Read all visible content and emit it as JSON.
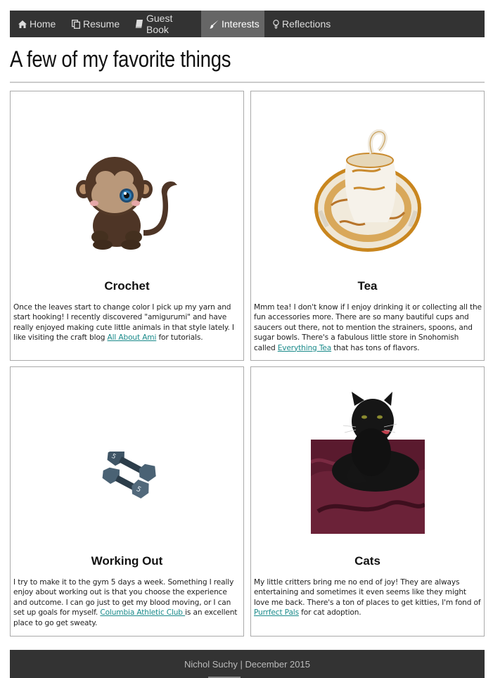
{
  "nav": {
    "items": [
      {
        "label": "Home",
        "icon": "home-icon",
        "active": false
      },
      {
        "label": "Resume",
        "icon": "copy-icon",
        "active": false
      },
      {
        "label": "Guest Book",
        "icon": "book-icon",
        "active": false
      },
      {
        "label": "Interests",
        "icon": "brush-icon",
        "active": true
      },
      {
        "label": "Reflections",
        "icon": "lightbulb-icon",
        "active": false
      }
    ]
  },
  "page": {
    "title": "A few of my favorite things"
  },
  "cards": [
    {
      "title": "Crochet",
      "image": "crochet-monkey-image",
      "text_before": "Once the leaves start to change color I pick up my yarn and start hooking! I recently discovered \"amigurumi\" and have really enjoyed making cute little animals in that style lately. I like visiting the craft blog ",
      "link": "All About Ami",
      "text_after": " for tutorials."
    },
    {
      "title": "Tea",
      "image": "teacup-image",
      "text_before": "Mmm tea! I don't know if I enjoy drinking it or collecting all the fun accessories more. There are so many bautiful cups and saucers out there, not to mention the strainers, spoons, and sugar bowls. There's a fabulous little store in Snohomish called ",
      "link": "Everything Tea",
      "text_after": " that has tons of flavors."
    },
    {
      "title": "Working Out",
      "image": "dumbbells-image",
      "text_before": "I try to make it to the gym 5 days a week. Something I really enjoy about working out is that you choose the experience and outcome. I can go just to get my blood moving, or I can set up goals for myself. ",
      "link": "Columbia Athletic Club ",
      "text_after": "is an excellent place to go get sweaty."
    },
    {
      "title": "Cats",
      "image": "black-cat-image",
      "text_before": "My little critters bring me no end of joy! They are always entertaining and sometimes it even seems like they might love me back. There's a ton of places to get kitties, I'm fond of ",
      "link": "Purrfect Pals",
      "text_after": " for cat adoption."
    }
  ],
  "dumbbell_weight": "5",
  "footer": {
    "text": "Nichol Suchy | December 2015"
  }
}
